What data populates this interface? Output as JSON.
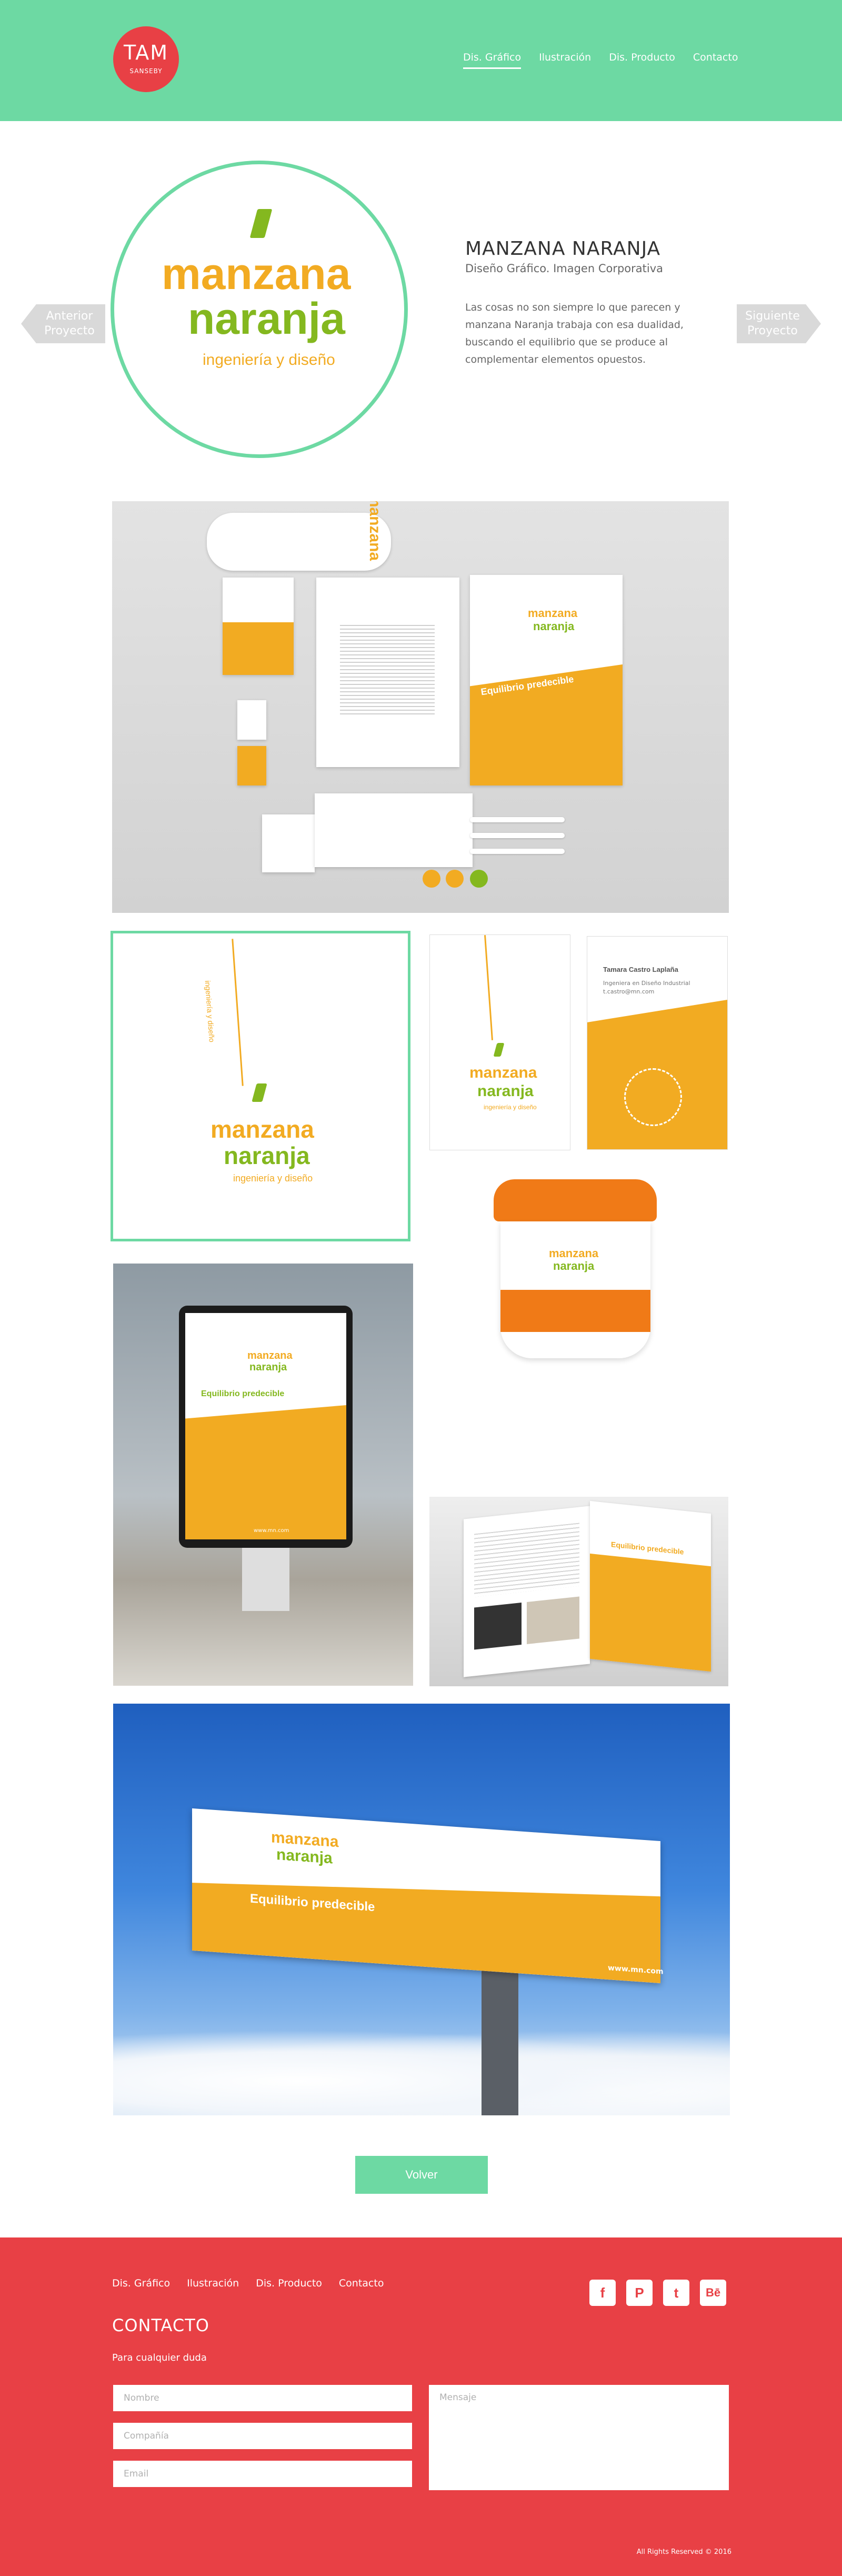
{
  "header": {
    "logo_main": "TAM",
    "logo_sub": "SANSEBY",
    "nav": [
      "Dis. Gráfico",
      "Ilustración",
      "Dis. Producto",
      "Contacto"
    ]
  },
  "project": {
    "brand_line1": "manzana",
    "brand_line2": "naranja",
    "brand_tag": "ingeniería y diseño",
    "title": "MANZANA NARANJA",
    "subtitle": "Diseño Gráfico. Imagen Corporativa",
    "description": "Las cosas no son siempre lo que parecen y manzana Naranja trabaja con esa dualidad, buscando el equilibrio que se produce al complementar elementos opuestos.",
    "prev": "Anterior Proyecto",
    "next": "Siguiente Proyecto"
  },
  "mockups": {
    "tagline": "Equilibrio predecible",
    "url": "www.mn.com",
    "card_name": "Tamara Castro Laplaña",
    "card_role": "Ingeniera en Diseño Industrial",
    "card_email": "t.castro@mn.com",
    "vertical_tag": "ingeniería y diseño"
  },
  "volver": "Volver",
  "footer": {
    "nav": [
      "Dis. Gráfico",
      "Ilustración",
      "Dis. Producto",
      "Contacto"
    ],
    "social": [
      "f",
      "P",
      "t",
      "Bē"
    ],
    "social_icons": [
      "facebook-icon",
      "pinterest-icon",
      "twitter-icon",
      "behance-icon"
    ],
    "contact_title": "CONTACTO",
    "contact_sub": "Para cualquier duda",
    "placeholders": {
      "name": "Nombre",
      "company": "Compañía",
      "email": "Email",
      "message": "Mensaje"
    },
    "rights": "All Rights Reserved © 2016"
  },
  "colors": {
    "green": "#6dd9a3",
    "red": "#e84045",
    "orange": "#f2ab22",
    "lime": "#84b81f"
  }
}
